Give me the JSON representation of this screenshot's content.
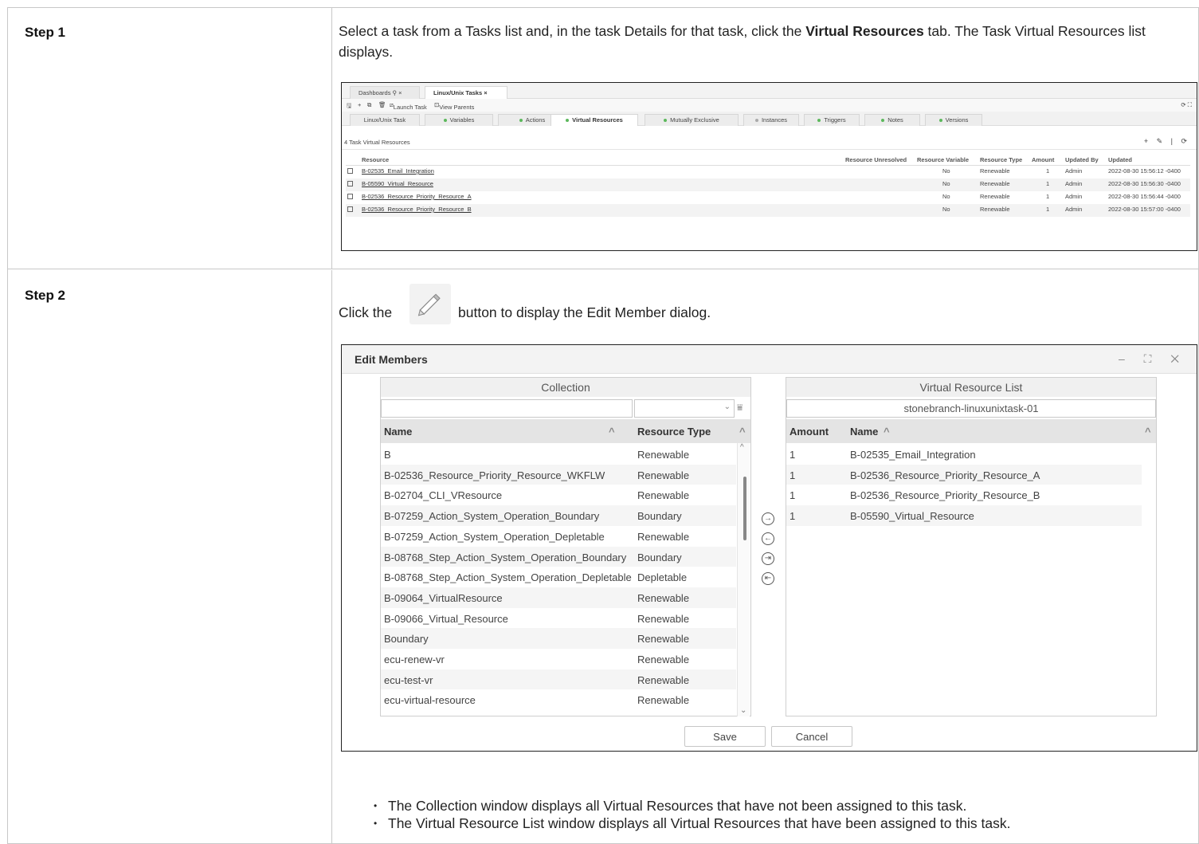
{
  "steps": [
    {
      "label": "Step 1",
      "text_before": "Select a task from a Tasks list and, in the task Details for that task, click the ",
      "text_bold": "Virtual Resources",
      "text_after": " tab. The Task Virtual Resources list displays."
    },
    {
      "label": "Step 2",
      "text_click": "Click the",
      "text_after_button": "button to display the Edit Member dialog.",
      "bullets": [
        "The Collection window displays all Virtual Resources that have not been assigned to this task.",
        "The Virtual Resource List window displays all Virtual Resources that have been assigned to this task."
      ]
    }
  ],
  "task_screen": {
    "window_tabs": [
      "Dashboards",
      "Linux/Unix Tasks"
    ],
    "window_tab_close": "×",
    "window_tab_pin": "⚲",
    "toolbar": {
      "launch": "Launch Task",
      "view_parents": "View Parents"
    },
    "detail_tabs": [
      {
        "label": "Linux/Unix Task",
        "dot": "none"
      },
      {
        "label": "Variables",
        "dot": "green"
      },
      {
        "label": "Actions",
        "dot": "green"
      },
      {
        "label": "Virtual Resources",
        "dot": "green",
        "active": true
      },
      {
        "label": "Mutually Exclusive",
        "dot": "green"
      },
      {
        "label": "Instances",
        "dot": "grey"
      },
      {
        "label": "Triggers",
        "dot": "green"
      },
      {
        "label": "Notes",
        "dot": "green"
      },
      {
        "label": "Versions",
        "dot": "green"
      }
    ],
    "list_title": "4 Task Virtual Resources",
    "list_icons": "+ ✎ | ⟳",
    "columns": [
      "Resource",
      "Resource Unresolved",
      "Resource Variable",
      "Resource Type",
      "Amount",
      "Updated By",
      "Updated"
    ],
    "rows": [
      {
        "resource": "B-02535_Email_Integration",
        "unresolved": "",
        "variable": "No",
        "type": "Renewable",
        "amount": "1",
        "by": "Admin",
        "updated": "2022-08-30 15:56:12 -0400"
      },
      {
        "resource": "B-05590_Virtual_Resource",
        "unresolved": "",
        "variable": "No",
        "type": "Renewable",
        "amount": "1",
        "by": "Admin",
        "updated": "2022-08-30 15:56:30 -0400"
      },
      {
        "resource": "B-02536_Resource_Priority_Resource_A",
        "unresolved": "",
        "variable": "No",
        "type": "Renewable",
        "amount": "1",
        "by": "Admin",
        "updated": "2022-08-30 15:56:44 -0400"
      },
      {
        "resource": "B-02536_Resource_Priority_Resource_B",
        "unresolved": "",
        "variable": "No",
        "type": "Renewable",
        "amount": "1",
        "by": "Admin",
        "updated": "2022-08-30 15:57:00 -0400"
      }
    ]
  },
  "dialog": {
    "title": "Edit Members",
    "window_buttons": "–  ⛶  ✕",
    "collection": {
      "title": "Collection",
      "search_value": "",
      "type_filter_value": "",
      "col_name": "Name",
      "col_type": "Resource Type",
      "sort_icon": "^",
      "rows": [
        {
          "name": "B",
          "type": "Renewable"
        },
        {
          "name": "B-02536_Resource_Priority_Resource_WKFLW",
          "type": "Renewable"
        },
        {
          "name": "B-02704_CLI_VResource",
          "type": "Renewable"
        },
        {
          "name": "B-07259_Action_System_Operation_Boundary",
          "type": "Boundary"
        },
        {
          "name": "B-07259_Action_System_Operation_Depletable",
          "type": "Renewable"
        },
        {
          "name": "B-08768_Step_Action_System_Operation_Boundary",
          "type": "Boundary"
        },
        {
          "name": "B-08768_Step_Action_System_Operation_Depletable",
          "type": "Depletable"
        },
        {
          "name": "B-09064_VirtualResource",
          "type": "Renewable"
        },
        {
          "name": "B-09066_Virtual_Resource",
          "type": "Renewable"
        },
        {
          "name": "Boundary",
          "type": "Renewable"
        },
        {
          "name": "ecu-renew-vr",
          "type": "Renewable"
        },
        {
          "name": "ecu-test-vr",
          "type": "Renewable"
        },
        {
          "name": "ecu-virtual-resource",
          "type": "Renewable"
        }
      ]
    },
    "transfer_buttons": [
      "→",
      "←",
      "⇥",
      "⇤"
    ],
    "vr_list": {
      "title": "Virtual Resource List",
      "task_name": "stonebranch-linuxunixtask-01",
      "col_amount": "Amount",
      "col_name": "Name",
      "sort_icon": "^",
      "rows": [
        {
          "amount": "1",
          "name": "B-02535_Email_Integration"
        },
        {
          "amount": "1",
          "name": "B-02536_Resource_Priority_Resource_A"
        },
        {
          "amount": "1",
          "name": "B-02536_Resource_Priority_Resource_B"
        },
        {
          "amount": "1",
          "name": "B-05590_Virtual_Resource"
        }
      ]
    },
    "save_label": "Save",
    "cancel_label": "Cancel"
  }
}
